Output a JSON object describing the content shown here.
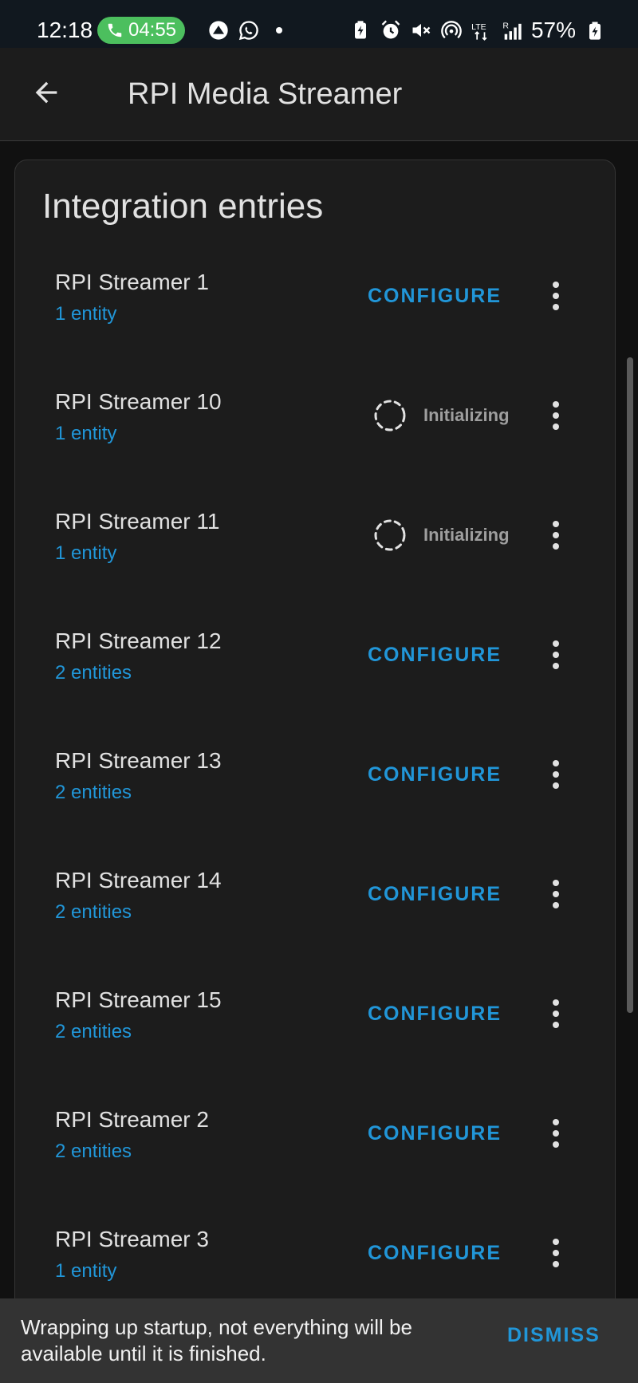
{
  "status_bar": {
    "time": "12:18",
    "call_timer": "04:55",
    "battery_percent": "57%",
    "left_icons": [
      "phone-icon",
      "notification-app-icon",
      "whatsapp-icon",
      "more-notifications-dot"
    ],
    "right_icons": [
      "battery-saver-icon",
      "alarm-icon",
      "mute-icon",
      "hotspot-icon",
      "lte-icon",
      "signal-icon",
      "battery-icon"
    ]
  },
  "app_bar": {
    "title": "RPI Media Streamer"
  },
  "card": {
    "title": "Integration entries",
    "entries": [
      {
        "name": "RPI Streamer 1",
        "sub": "1 entity",
        "state": "configure",
        "action_label": "CONFIGURE"
      },
      {
        "name": "RPI Streamer 10",
        "sub": "1 entity",
        "state": "initializing",
        "action_label": "Initializing"
      },
      {
        "name": "RPI Streamer 11",
        "sub": "1 entity",
        "state": "initializing",
        "action_label": "Initializing"
      },
      {
        "name": "RPI Streamer 12",
        "sub": "2 entities",
        "state": "configure",
        "action_label": "CONFIGURE"
      },
      {
        "name": "RPI Streamer 13",
        "sub": "2 entities",
        "state": "configure",
        "action_label": "CONFIGURE"
      },
      {
        "name": "RPI Streamer 14",
        "sub": "2 entities",
        "state": "configure",
        "action_label": "CONFIGURE"
      },
      {
        "name": "RPI Streamer 15",
        "sub": "2 entities",
        "state": "configure",
        "action_label": "CONFIGURE"
      },
      {
        "name": "RPI Streamer 2",
        "sub": "2 entities",
        "state": "configure",
        "action_label": "CONFIGURE"
      },
      {
        "name": "RPI Streamer 3",
        "sub": "1 entity",
        "state": "configure",
        "action_label": "CONFIGURE"
      }
    ]
  },
  "snackbar": {
    "message": "Wrapping up startup, not everything will be available until it is finished.",
    "dismiss_label": "DISMISS"
  },
  "colors": {
    "accent": "#2196d8",
    "background": "#111111",
    "surface": "#1c1c1c",
    "snackbar": "#333333",
    "call_pill": "#4cbf5e"
  }
}
